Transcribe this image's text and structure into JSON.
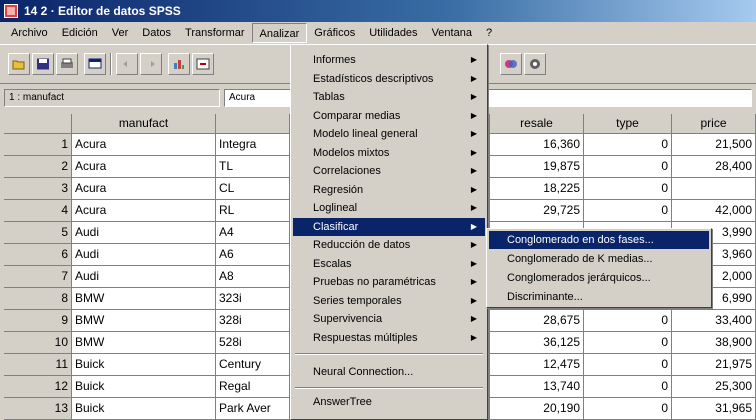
{
  "window": {
    "title": "14 2 · Editor de datos SPSS"
  },
  "menubar": [
    "Archivo",
    "Edición",
    "Ver",
    "Datos",
    "Transformar",
    "Analizar",
    "Gráficos",
    "Utilidades",
    "Ventana",
    "?"
  ],
  "cellbar": {
    "ref": "1 : manufact",
    "value": "Acura"
  },
  "grid": {
    "headers": [
      "manufact",
      "",
      "resale",
      "type",
      "price"
    ],
    "rows": [
      {
        "n": "1",
        "manufact": "Acura",
        "model": "Integra",
        "resale": "16,360",
        "type": "0",
        "price": "21,500"
      },
      {
        "n": "2",
        "manufact": "Acura",
        "model": "TL",
        "resale": "19,875",
        "type": "0",
        "price": "28,400"
      },
      {
        "n": "3",
        "manufact": "Acura",
        "model": "CL",
        "resale": "18,225",
        "type": "0",
        "price": ""
      },
      {
        "n": "4",
        "manufact": "Acura",
        "model": "RL",
        "resale": "29,725",
        "type": "0",
        "price": "42,000"
      },
      {
        "n": "5",
        "manufact": "Audi",
        "model": "A4",
        "resale": "",
        "type": "",
        "price": "3,990"
      },
      {
        "n": "6",
        "manufact": "Audi",
        "model": "A6",
        "resale": "",
        "type": "",
        "price": "3,960"
      },
      {
        "n": "7",
        "manufact": "Audi",
        "model": "A8",
        "resale": "",
        "type": "",
        "price": "2,000"
      },
      {
        "n": "8",
        "manufact": "BMW",
        "model": "323i",
        "resale": "",
        "type": "",
        "price": "6,990"
      },
      {
        "n": "9",
        "manufact": "BMW",
        "model": "328i",
        "resale": "28,675",
        "type": "0",
        "price": "33,400"
      },
      {
        "n": "10",
        "manufact": "BMW",
        "model": "528i",
        "resale": "36,125",
        "type": "0",
        "price": "38,900"
      },
      {
        "n": "11",
        "manufact": "Buick",
        "model": "Century",
        "resale": "12,475",
        "type": "0",
        "price": "21,975"
      },
      {
        "n": "12",
        "manufact": "Buick",
        "model": "Regal",
        "resale": "13,740",
        "type": "0",
        "price": "25,300"
      },
      {
        "n": "13",
        "manufact": "Buick",
        "model": "Park Aver",
        "resale": "20,190",
        "type": "0",
        "price": "31,965"
      }
    ]
  },
  "analizar_menu": {
    "items": [
      {
        "label": "Informes",
        "sub": true
      },
      {
        "label": "Estadísticos descriptivos",
        "sub": true
      },
      {
        "label": "Tablas",
        "sub": true
      },
      {
        "label": "Comparar medias",
        "sub": true
      },
      {
        "label": "Modelo lineal general",
        "sub": true
      },
      {
        "label": "Modelos mixtos",
        "sub": true
      },
      {
        "label": "Correlaciones",
        "sub": true
      },
      {
        "label": "Regresión",
        "sub": true
      },
      {
        "label": "Loglineal",
        "sub": true
      },
      {
        "label": "Clasificar",
        "sub": true,
        "selected": true
      },
      {
        "label": "Reducción de datos",
        "sub": true
      },
      {
        "label": "Escalas",
        "sub": true
      },
      {
        "label": "Pruebas no paramétricas",
        "sub": true
      },
      {
        "label": "Series temporales",
        "sub": true
      },
      {
        "label": "Supervivencia",
        "sub": true
      },
      {
        "label": "Respuestas múltiples",
        "sub": true
      }
    ],
    "extra": [
      "Neural Connection...",
      "AnswerTree"
    ]
  },
  "clasificar_submenu": [
    {
      "label": "Conglomerado en dos fases...",
      "selected": true
    },
    {
      "label": "Conglomerado de K medias..."
    },
    {
      "label": "Conglomerados jerárquicos..."
    },
    {
      "label": "Discriminante..."
    }
  ]
}
